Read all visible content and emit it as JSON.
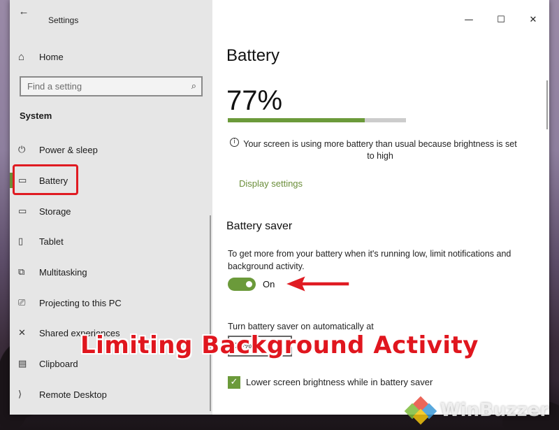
{
  "window": {
    "title": "Settings",
    "controls": {
      "minimize": "—",
      "maximize": "☐",
      "close": "✕"
    }
  },
  "sidebar": {
    "home_label": "Home",
    "search_placeholder": "Find a setting",
    "section": "System",
    "items": [
      {
        "label": "Power & sleep",
        "icon": "power-icon",
        "glyph": "⏻"
      },
      {
        "label": "Battery",
        "icon": "battery-icon",
        "glyph": "▭",
        "active": true
      },
      {
        "label": "Storage",
        "icon": "storage-icon",
        "glyph": "▭"
      },
      {
        "label": "Tablet",
        "icon": "tablet-icon",
        "glyph": "▯"
      },
      {
        "label": "Multitasking",
        "icon": "multitasking-icon",
        "glyph": "⧉"
      },
      {
        "label": "Projecting to this PC",
        "icon": "projecting-icon",
        "glyph": "⎚"
      },
      {
        "label": "Shared experiences",
        "icon": "shared-experiences-icon",
        "glyph": "✕"
      },
      {
        "label": "Clipboard",
        "icon": "clipboard-icon",
        "glyph": "📋"
      },
      {
        "label": "Remote Desktop",
        "icon": "remote-desktop-icon",
        "glyph": "⟩"
      }
    ]
  },
  "main": {
    "title": "Battery",
    "percent": "77%",
    "percent_value": 0.77,
    "info_text": "Your screen is using more battery than usual because brightness is set to high",
    "display_settings_link": "Display settings",
    "battery_saver": {
      "heading": "Battery saver",
      "description": "To get more from your battery when it's running low, limit notifications and background activity.",
      "toggle_state": "On",
      "auto_label": "Turn battery saver on automatically at",
      "auto_value": "20%",
      "checkbox_label": "Lower screen brightness while in battery saver",
      "checkbox_checked": true
    }
  },
  "overlay": {
    "caption": "Limiting Background Activity",
    "watermark": "WinBuzzer"
  },
  "colors": {
    "accent": "#6b9a3a",
    "highlight_red": "#e01b22",
    "sidebar_bg": "#e6e6e6"
  }
}
